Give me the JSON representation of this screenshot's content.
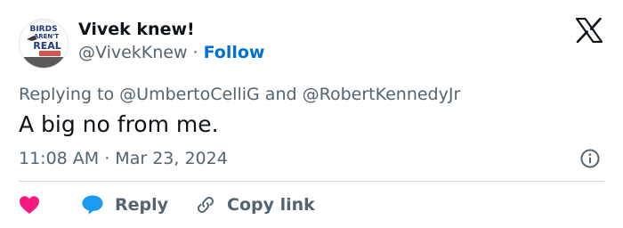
{
  "author": {
    "display_name": "Vivek knew!",
    "handle": "@VivekKnew",
    "separator": "·",
    "follow_label": "Follow",
    "avatar_text": {
      "line1": "BIRDS",
      "line2": "AREN'T",
      "line3": "REAL"
    }
  },
  "platform_logo": "x-logo-icon",
  "reply_context": {
    "prefix": "Replying to",
    "mention1": "@UmbertoCelliG",
    "conjunction": "and",
    "mention2": "@RobertKennedyJr"
  },
  "tweet": {
    "text": "A big no from me.",
    "timestamp": "11:08 AM · Mar 23, 2024"
  },
  "actions": {
    "like_icon": "heart-icon",
    "reply_icon": "speech-bubble-icon",
    "reply_label": "Reply",
    "copy_icon": "link-icon",
    "copy_label": "Copy link"
  },
  "colors": {
    "text_primary": "#0f1419",
    "text_secondary": "#536471",
    "follow_blue": "#006fd6",
    "like_pink": "#f91880",
    "reply_blue": "#1d9bf0",
    "divider": "#cfd9de"
  }
}
